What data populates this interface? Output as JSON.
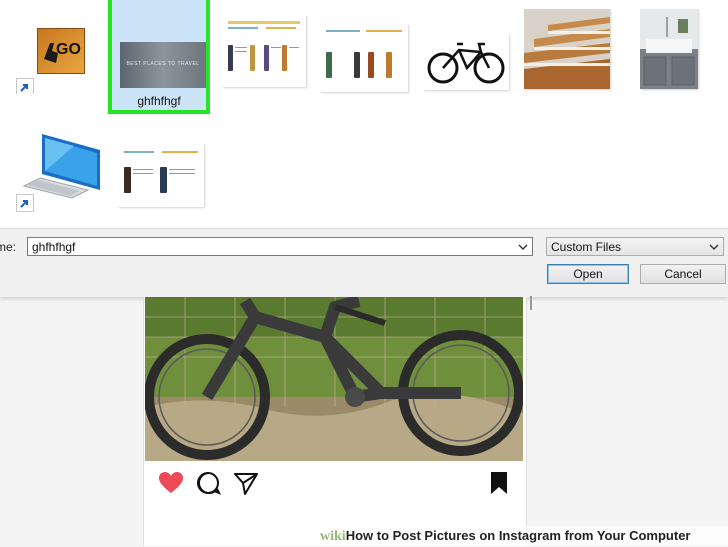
{
  "dialog": {
    "selected_file_label": "ghfhfhgf",
    "selected_thumb_caption": "BEST PLACES TO TRAVEL",
    "file_name_label": "me:",
    "file_name_value": "ghfhfhgf",
    "file_type_value": "Custom Files",
    "open_button": "Open",
    "cancel_button": "Cancel",
    "files": [
      {
        "name": "csgo-shortcut",
        "icon": "csgo-icon",
        "thumb_text": "GO"
      },
      {
        "name": "ghfhfhgf",
        "icon": "image-thumb"
      },
      {
        "name": "doc-flyer-1",
        "icon": "document-thumb"
      },
      {
        "name": "doc-flyer-2",
        "icon": "document-thumb"
      },
      {
        "name": "bicycle",
        "icon": "bicycle-thumb"
      },
      {
        "name": "stairs",
        "icon": "stairs-thumb"
      },
      {
        "name": "kitchen",
        "icon": "kitchen-thumb"
      },
      {
        "name": "this-pc-shortcut",
        "icon": "computer-icon"
      },
      {
        "name": "doc-flyer-3",
        "icon": "document-thumb"
      }
    ]
  },
  "post": {
    "photo_subject": "mountain-bike",
    "actions": [
      "heart-icon",
      "comment-icon",
      "share-icon",
      "bookmark-icon"
    ]
  },
  "watermark": {
    "wiki": "wiki",
    "how": "How",
    "rest": " to Post Pictures on Instagram from Your Computer"
  },
  "colors": {
    "selection_highlight": "#22e622",
    "selection_fill": "#cce4f7",
    "heart": "#ed4956",
    "wiki_green": "#93b874"
  }
}
